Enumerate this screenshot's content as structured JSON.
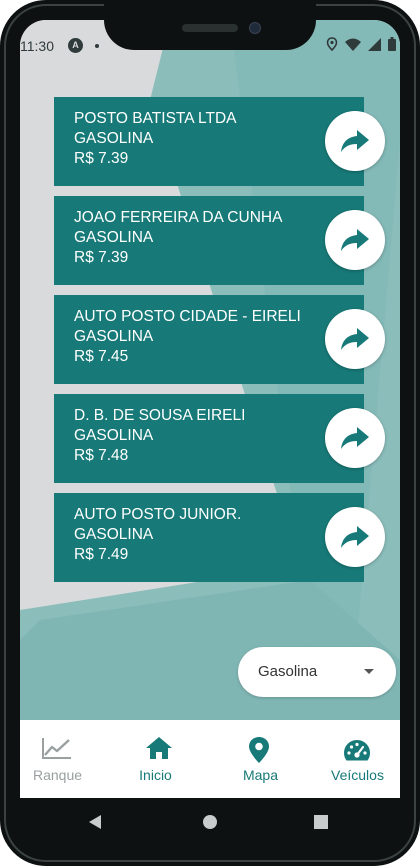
{
  "status_bar": {
    "time": "11:30",
    "app_badge": "A"
  },
  "stations": [
    {
      "name": "POSTO BATISTA LTDA",
      "fuel": "GASOLINA",
      "price": "R$ 7.39"
    },
    {
      "name": "JOAO FERREIRA DA CUNHA",
      "fuel": "GASOLINA",
      "price": "R$ 7.39"
    },
    {
      "name": "AUTO POSTO CIDADE - EIRELI",
      "fuel": "GASOLINA",
      "price": "R$ 7.45"
    },
    {
      "name": "D. B. DE SOUSA EIRELI",
      "fuel": "GASOLINA",
      "price": "R$ 7.48"
    },
    {
      "name": "AUTO POSTO JUNIOR.",
      "fuel": "GASOLINA",
      "price": "R$ 7.49"
    }
  ],
  "fuel_select": {
    "value": "Gasolina"
  },
  "nav": [
    {
      "label": "Ranque",
      "icon": "chart-line-icon",
      "active": false
    },
    {
      "label": "Inicio",
      "icon": "home-icon",
      "active": true
    },
    {
      "label": "Mapa",
      "icon": "map-pin-icon",
      "active": true
    },
    {
      "label": "Veículos",
      "icon": "speedometer-icon",
      "active": true
    }
  ],
  "colors": {
    "primary": "#177a78",
    "inactive": "#9aa0a0",
    "background": "#d9dadb"
  }
}
